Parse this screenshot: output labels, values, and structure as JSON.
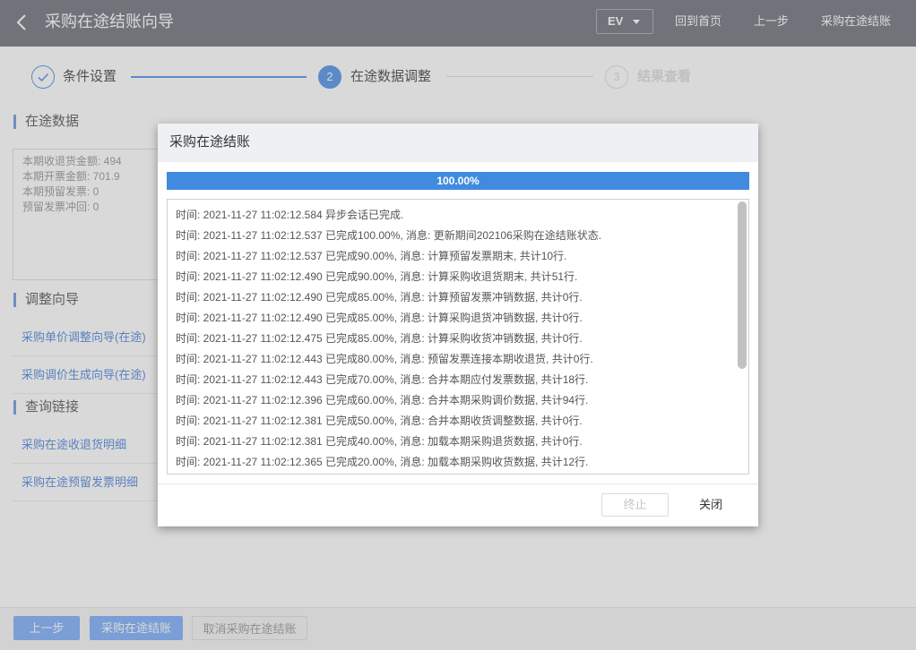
{
  "colors": {
    "header_bg": "#848990",
    "primary": "#6ba3ea",
    "link": "#6a99e1",
    "section_bar": "#83a8e1",
    "button_blue": "#90bafb",
    "progress": "#408be0"
  },
  "header": {
    "back_icon": "chevron-left-icon",
    "title": "采购在途结账向导",
    "org_select": {
      "value": "EV",
      "caret_icon": "caret-down-icon"
    },
    "home_link": "回到首页",
    "prev_link": "上一步",
    "close_link": "采购在途结账"
  },
  "steps": [
    {
      "icon": "check-icon",
      "label": "条件设置",
      "completed": true,
      "active": false
    },
    {
      "number": "2",
      "label": "在途数据调整",
      "completed": false,
      "active": true
    },
    {
      "number": "3",
      "label": "结果查看",
      "completed": false,
      "active": false
    }
  ],
  "sections": {
    "in_transit": {
      "title": "在途数据",
      "lines": [
        "本期收退货金额: 494",
        "本期开票金额: 701.9",
        "本期预留发票: 0",
        "预留发票冲回: 0"
      ]
    },
    "adjust": {
      "title": "调整向导",
      "links": [
        "采购单价调整向导(在途)",
        "采购调价生成向导(在途)"
      ]
    },
    "query": {
      "title": "查询链接",
      "links": [
        "采购在途收退货明细",
        "采购在途预留发票明细"
      ]
    }
  },
  "footer": {
    "prev": "上一步",
    "confirm": "采购在途结账",
    "cancel": "取消采购在途结账"
  },
  "modal": {
    "title": "采购在途结账",
    "progress": {
      "percent": 100,
      "label": "100.00%"
    },
    "log": [
      "时间: 2021-11-27 11:02:12.584 异步会话已完成.",
      "时间: 2021-11-27 11:02:12.537 已完成100.00%, 消息: 更新期间202106采购在途结账状态.",
      "时间: 2021-11-27 11:02:12.537 已完成90.00%, 消息: 计算预留发票期末, 共计10行.",
      "时间: 2021-11-27 11:02:12.490 已完成90.00%, 消息: 计算采购收退货期末, 共计51行.",
      "时间: 2021-11-27 11:02:12.490 已完成85.00%, 消息: 计算预留发票冲销数据, 共计0行.",
      "时间: 2021-11-27 11:02:12.490 已完成85.00%, 消息: 计算采购退货冲销数据, 共计0行.",
      "时间: 2021-11-27 11:02:12.475 已完成85.00%, 消息: 计算采购收货冲销数据, 共计0行.",
      "时间: 2021-11-27 11:02:12.443 已完成80.00%, 消息: 预留发票连接本期收退货, 共计0行.",
      "时间: 2021-11-27 11:02:12.443 已完成70.00%, 消息: 合并本期应付发票数据, 共计18行.",
      "时间: 2021-11-27 11:02:12.396 已完成60.00%, 消息: 合并本期采购调价数据, 共计94行.",
      "时间: 2021-11-27 11:02:12.381 已完成50.00%, 消息: 合并本期收货调整数据, 共计0行.",
      "时间: 2021-11-27 11:02:12.381 已完成40.00%, 消息: 加载本期采购退货数据, 共计0行.",
      "时间: 2021-11-27 11:02:12.365 已完成20.00%, 消息: 加载本期采购收货数据, 共计12行."
    ],
    "buttons": {
      "stop": "终止",
      "close": "关闭"
    }
  }
}
